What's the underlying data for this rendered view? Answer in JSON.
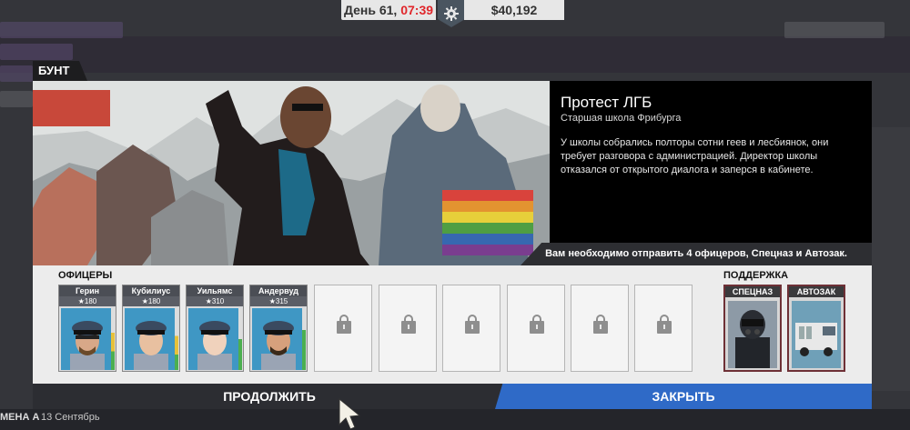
{
  "hud": {
    "day_label": "День 61,",
    "time": "07:39",
    "money": "$40,192",
    "settings_icon": "gear-icon"
  },
  "incident": {
    "category": "БУНТ",
    "title": "Протест ЛГБ",
    "location": "Старшая школа Фрибурга",
    "description": "У школы собрались полторы сотни геев и лесбиянок, они требует разговора с администрацией. Директор школы отказался от открытого диалога и заперся в кабинете.",
    "requirement": "Вам необходимо отправить 4 офицеров, Спецназ и Автозак."
  },
  "roster": {
    "officers_heading": "ОФИЦЕРЫ",
    "support_heading": "ПОДДЕРЖКА",
    "officers": [
      {
        "name": "Герин",
        "rank": "★180"
      },
      {
        "name": "Кубилиус",
        "rank": "★180"
      },
      {
        "name": "Уильямс",
        "rank": "★310"
      },
      {
        "name": "Андервуд",
        "rank": "★315"
      }
    ],
    "empty_slots": 6,
    "support": [
      {
        "name": "СПЕЦНАЗ",
        "icon": "swat-icon"
      },
      {
        "name": "АВТОЗАК",
        "icon": "van-icon"
      }
    ]
  },
  "actions": {
    "continue": "ПРОДОЛЖИТЬ",
    "close": "ЗАКРЫТЬ"
  },
  "statusbar": {
    "shift": "МЕНА А",
    "date": "13 Сентябрь"
  },
  "colors": {
    "accent_blue": "#2f6ac7",
    "time_red": "#e0262b",
    "support_border": "#6e3036"
  }
}
